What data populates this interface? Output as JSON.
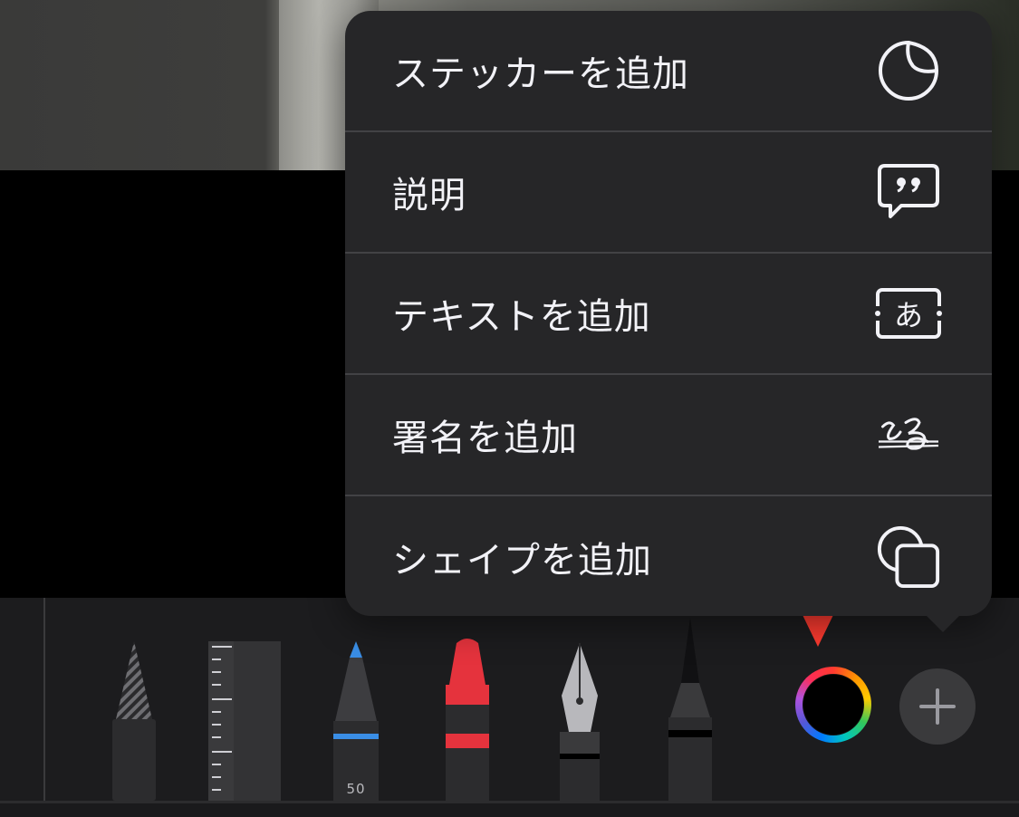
{
  "menu": {
    "items": [
      {
        "label": "ステッカーを追加",
        "icon": "sticker-icon"
      },
      {
        "label": "説明",
        "icon": "description-quote-icon"
      },
      {
        "label": "テキストを追加",
        "icon": "text-box-icon",
        "icon_text": "あ"
      },
      {
        "label": "署名を追加",
        "icon": "signature-icon"
      },
      {
        "label": "シェイプを追加",
        "icon": "shapes-icon"
      }
    ]
  },
  "toolbar": {
    "tools": [
      "lasso-pencil",
      "ruler",
      "pen-blue",
      "crayon-red",
      "fountain-pen",
      "brush-black"
    ],
    "pen_width_label": "50",
    "color_picker_selected": "#000000",
    "add_button": "plus-icon"
  },
  "colors": {
    "menu_background": "#262628",
    "menu_text": "#f2f2f7",
    "arrow": "#ff3b30",
    "pen_blue": "#3a8ee6",
    "crayon_red": "#e5333d"
  }
}
